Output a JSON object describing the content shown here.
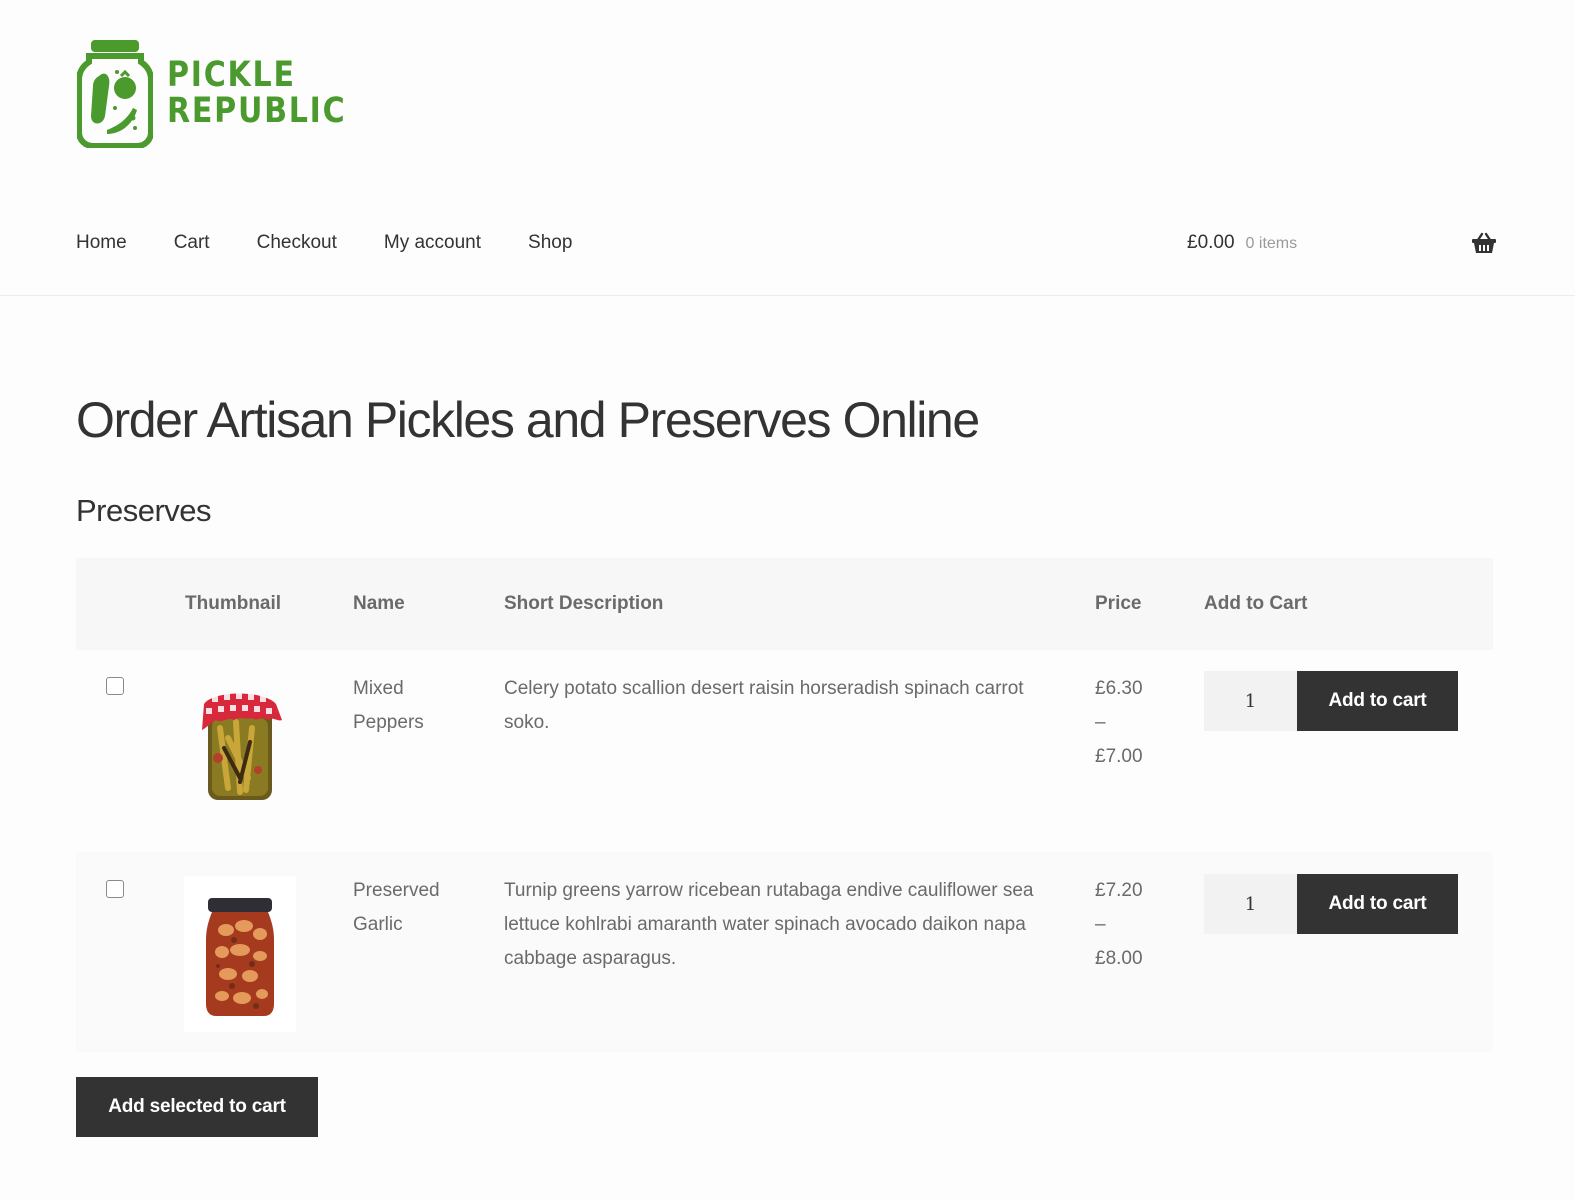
{
  "brand": {
    "name_line1": "PICKLE",
    "name_line2": "REPUBLIC",
    "color": "#4a9a2e",
    "logo_icon": "pickle-jar-icon"
  },
  "nav": {
    "items": [
      {
        "label": "Home"
      },
      {
        "label": "Cart"
      },
      {
        "label": "Checkout"
      },
      {
        "label": "My account"
      },
      {
        "label": "Shop"
      }
    ]
  },
  "cart": {
    "total": "£0.00",
    "count": "0 items",
    "icon": "basket-icon"
  },
  "page": {
    "title": "Order Artisan Pickles and Preserves Online",
    "section_title": "Preserves"
  },
  "table": {
    "headers": {
      "select": "",
      "thumbnail": "Thumbnail",
      "name": "Name",
      "description": "Short Description",
      "price": "Price",
      "add_to_cart": "Add to Cart"
    },
    "rows": [
      {
        "checked": false,
        "thumbnail": "mixed-peppers-jar",
        "name_line1": "Mixed",
        "name_line2": "Peppers",
        "description": "Celery potato scallion desert raisin horseradish spinach carrot soko.",
        "price_min": "£6.30",
        "price_sep": "–",
        "price_max": "£7.00",
        "quantity": "1",
        "button_label": "Add to cart"
      },
      {
        "checked": false,
        "thumbnail": "preserved-garlic-jar",
        "name_line1": "Preserved",
        "name_line2": "Garlic",
        "description": "Turnip greens yarrow ricebean rutabaga endive cauliflower sea lettuce kohlrabi amaranth water spinach avocado daikon napa cabbage asparagus.",
        "price_min": "£7.20",
        "price_sep": "–",
        "price_max": "£8.00",
        "quantity": "1",
        "button_label": "Add to cart"
      }
    ]
  },
  "actions": {
    "add_selected_label": "Add selected to cart"
  },
  "colors": {
    "button_bg": "#333333",
    "header_row_bg": "#f7f7f7",
    "text_muted": "#6a6a6a"
  }
}
